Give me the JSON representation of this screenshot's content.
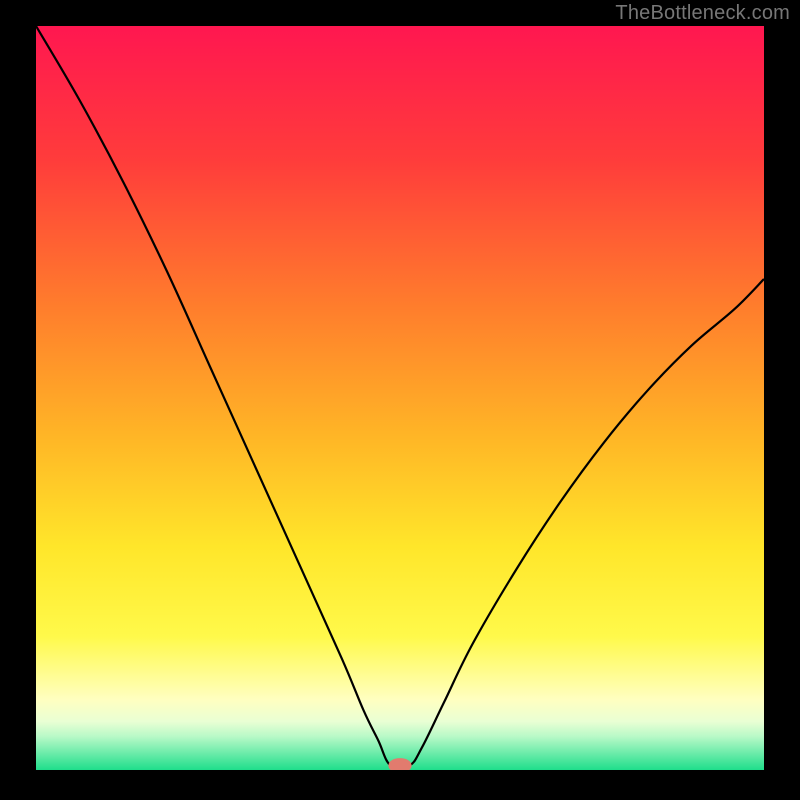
{
  "attribution": "TheBottleneck.com",
  "chart_data": {
    "type": "line",
    "title": "",
    "xlabel": "",
    "ylabel": "",
    "xlim": [
      0,
      100
    ],
    "ylim": [
      0,
      100
    ],
    "background_gradient": {
      "stops": [
        {
          "pos": 0.0,
          "color": "#ff1750"
        },
        {
          "pos": 0.18,
          "color": "#ff3c3b"
        },
        {
          "pos": 0.38,
          "color": "#ff7e2c"
        },
        {
          "pos": 0.55,
          "color": "#ffb526"
        },
        {
          "pos": 0.7,
          "color": "#ffe62a"
        },
        {
          "pos": 0.82,
          "color": "#fff94a"
        },
        {
          "pos": 0.905,
          "color": "#ffffc0"
        },
        {
          "pos": 0.935,
          "color": "#e9ffd4"
        },
        {
          "pos": 0.955,
          "color": "#b8f9c7"
        },
        {
          "pos": 0.975,
          "color": "#74edad"
        },
        {
          "pos": 1.0,
          "color": "#1fde8b"
        }
      ]
    },
    "series": [
      {
        "name": "bottleneck-curve",
        "x": [
          0,
          6,
          12,
          18,
          24,
          30,
          36,
          42,
          45,
          47,
          48.7,
          51.3,
          53,
          56,
          60,
          66,
          72,
          78,
          84,
          90,
          96,
          100
        ],
        "y": [
          100,
          90,
          79,
          67,
          54,
          41,
          28,
          15,
          8,
          4,
          0.6,
          0.6,
          3,
          9,
          17,
          27,
          36,
          44,
          51,
          57,
          62,
          66
        ]
      }
    ],
    "marker": {
      "x": 50.0,
      "y": 0.6,
      "rx": 1.6,
      "ry": 1.0,
      "color": "#e27b6e"
    }
  }
}
